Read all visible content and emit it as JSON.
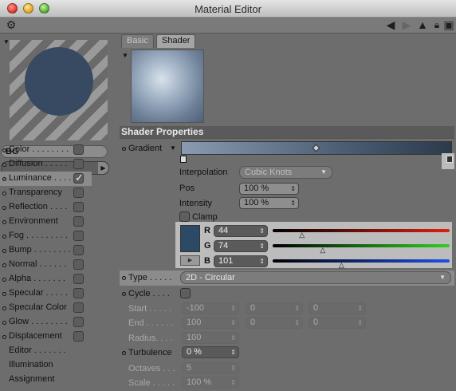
{
  "window": {
    "title": "Material Editor"
  },
  "left": {
    "material_name": "BG",
    "channels": [
      {
        "label": "Color . . . . . . . .",
        "checked": false,
        "dot": true
      },
      {
        "label": "Diffusion . . . . .",
        "checked": false,
        "dot": true
      },
      {
        "label": "Luminance . . . .",
        "checked": true,
        "dot": true,
        "highlight": true
      },
      {
        "label": "Transparency",
        "checked": false,
        "dot": true
      },
      {
        "label": "Reflection . . . .",
        "checked": false,
        "dot": true
      },
      {
        "label": "Environment",
        "checked": false,
        "dot": true
      },
      {
        "label": "Fog . . . . . . . . .",
        "checked": false,
        "dot": true
      },
      {
        "label": "Bump . . . . . . . .",
        "checked": false,
        "dot": true
      },
      {
        "label": "Normal . . . . . .",
        "checked": false,
        "dot": true
      },
      {
        "label": "Alpha . . . . . . .",
        "checked": false,
        "dot": true
      },
      {
        "label": "Specular . . . . .",
        "checked": false,
        "dot": true
      },
      {
        "label": "Specular Color",
        "checked": false,
        "dot": true
      },
      {
        "label": "Glow . . . . . . . .",
        "checked": false,
        "dot": true
      },
      {
        "label": "Displacement",
        "checked": false,
        "dot": true
      }
    ],
    "extra_items": [
      "Editor . . . . . . .",
      "Illumination",
      "Assignment"
    ]
  },
  "right": {
    "tabs": [
      "Basic",
      "Shader"
    ],
    "active_tab": "Shader",
    "section_title": "Shader Properties",
    "gradient_label": "Gradient",
    "interpolation_label": "Interpolation",
    "interpolation_value": "Cubic Knots",
    "pos_label": "Pos",
    "pos_value": "100 %",
    "intensity_label": "Intensity",
    "intensity_value": "100 %",
    "clamp_label": "Clamp",
    "color": {
      "r_label": "R",
      "r": "44",
      "g_label": "G",
      "g": "74",
      "b_label": "B",
      "b": "101",
      "swatch_hex": "#2c4a65"
    },
    "type_label": "Type . . . . .",
    "type_value": "2D - Circular",
    "cycle_label": "Cycle . . . .",
    "start_label": "Start . . . . .",
    "start_values": [
      "-100",
      "0",
      "0"
    ],
    "end_label": "End . . . . . .",
    "end_values": [
      "100",
      "0",
      "0"
    ],
    "radius_label": "Radius. . . .",
    "radius_value": "100",
    "turbulence_label": "Turbulence",
    "turbulence_value": "0 %",
    "octaves_label": "Octaves . . .",
    "octaves_value": "5",
    "scale_label": "Scale . . . . .",
    "scale_value": "100 %"
  }
}
